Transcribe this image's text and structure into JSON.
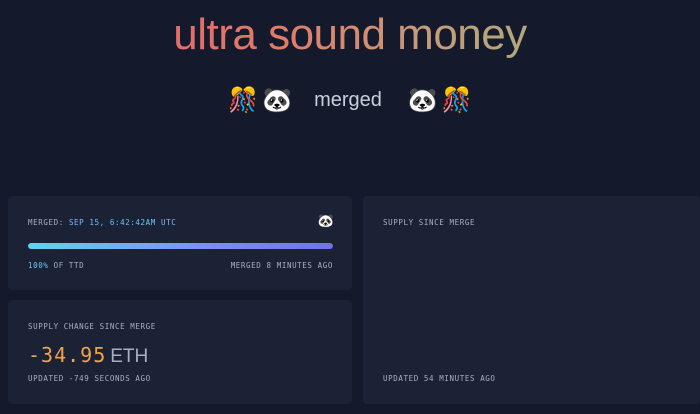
{
  "header": {
    "title": "ultra sound money",
    "merged_label": "merged",
    "left_emojis": [
      "🎊",
      "🐼"
    ],
    "right_emojis": [
      "🐼",
      "🎊"
    ]
  },
  "merge_card": {
    "merged_prefix": "MERGED: ",
    "merged_time": "SEP 15, 6:42:42AM UTC",
    "icon": "panda-icon",
    "progress_percent": 100,
    "progress_value": "100%",
    "progress_suffix": " OF TTD",
    "merged_ago": "MERGED 8 MINUTES AGO"
  },
  "supply_change_card": {
    "label": "SUPPLY CHANGE SINCE MERGE",
    "value": "-34.95",
    "unit": "ETH",
    "updated": "UPDATED -749 SECONDS AGO"
  },
  "supply_since_card": {
    "label": "SUPPLY SINCE MERGE",
    "updated": "UPDATED 54 MINUTES AGO"
  },
  "colors": {
    "background": "#141a2c",
    "card": "#1c2236",
    "accent_blue": "#6cc3f4",
    "accent_orange": "#f0a44c"
  }
}
